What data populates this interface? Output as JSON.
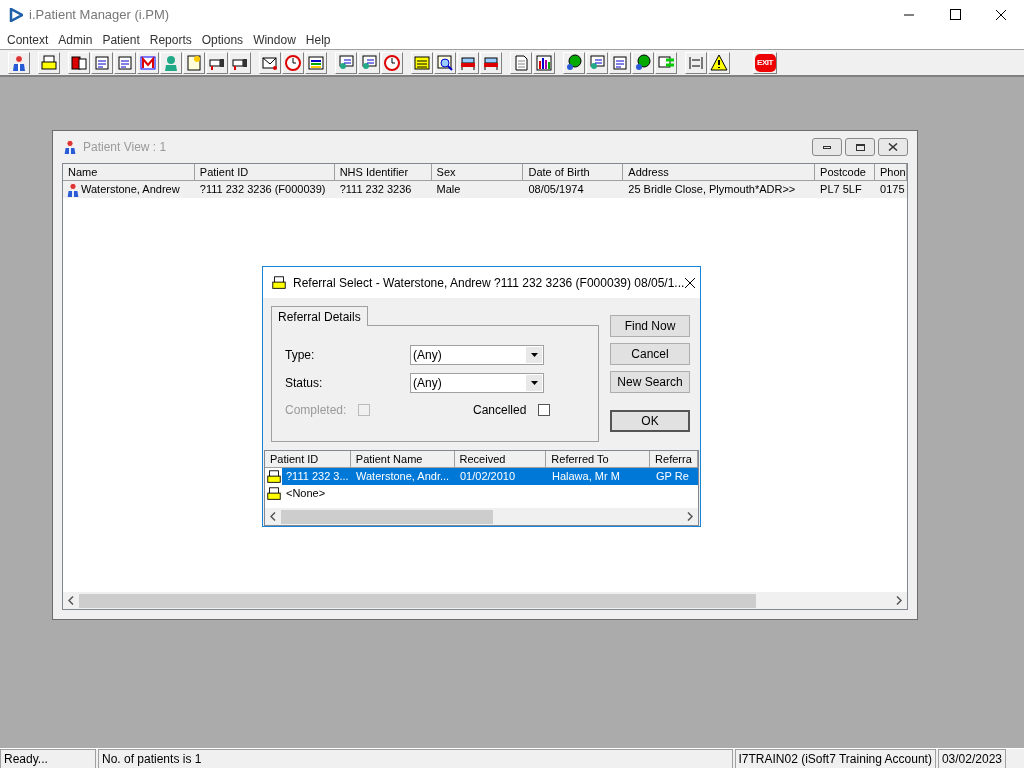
{
  "window": {
    "title": "i.Patient Manager (i.PM)"
  },
  "menu": [
    "Context",
    "Admin",
    "Patient",
    "Reports",
    "Options",
    "Window",
    "Help"
  ],
  "toolbar": {
    "exit_label": "EXIT"
  },
  "patient_view": {
    "title": "Patient View : 1",
    "columns": [
      "Name",
      "Patient ID",
      "NHS Identifier",
      "Sex",
      "Date of Birth",
      "Address",
      "Postcode",
      "Phon"
    ],
    "rows": [
      {
        "cells": [
          "Waterstone, Andrew",
          "?111 232 3236 (F000039)",
          "?111 232 3236",
          "Male",
          "08/05/1974",
          "25 Bridle Close, Plymouth*ADR>>",
          "PL7 5LF",
          "0175"
        ],
        "selected": false
      }
    ]
  },
  "dialog": {
    "title": "Referral Select - Waterstone, Andrew ?111 232 3236 (F000039) 08/05/1...",
    "tabs": [
      {
        "label": "Referral Details",
        "selected": true
      }
    ],
    "fields": [
      {
        "label": "Type:",
        "value": "(Any)"
      },
      {
        "label": "Status:",
        "value": "(Any)"
      }
    ],
    "checkboxes": [
      {
        "label": "Completed:",
        "checked": false,
        "disabled": true
      },
      {
        "label": "Cancelled",
        "checked": false,
        "disabled": false
      }
    ],
    "buttons": [
      "Find Now",
      "Cancel",
      "New Search",
      "OK"
    ],
    "columns": [
      "Patient ID",
      "Patient Name",
      "Received",
      "Referred To",
      "Referra"
    ],
    "rows": [
      {
        "cells": [
          "?111 232 3...",
          "Waterstone, Andr...",
          "01/02/2010",
          "Halawa, Mr M",
          "GP Re"
        ],
        "selected": true
      },
      {
        "cells": [
          "<None>"
        ],
        "selected": false
      }
    ]
  },
  "status_bar": [
    "Ready...",
    "No. of patients is 1",
    "I7TRAIN02 (iSoft7 Training Account)",
    "03/02/2023"
  ]
}
